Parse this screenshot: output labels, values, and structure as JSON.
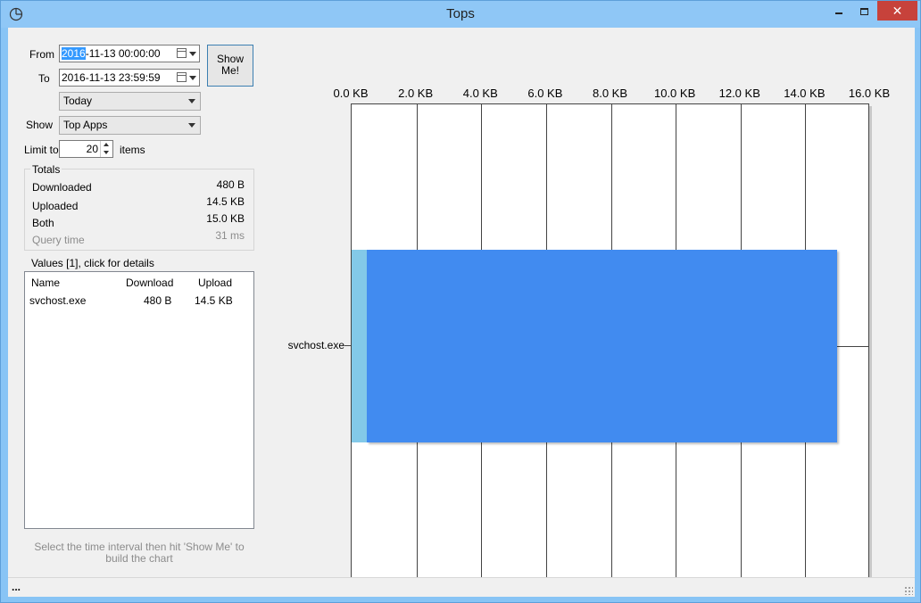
{
  "window": {
    "title": "Tops"
  },
  "form": {
    "from_label": "From",
    "from_selected": "2016",
    "from_rest": "-11-13 00:00:00",
    "to_label": "To",
    "to_value": "2016-11-13 23:59:59",
    "show_button": "Show Me!",
    "range_value": "Today",
    "show_label": "Show",
    "show_value": "Top Apps",
    "limit_label": "Limit to",
    "limit_value": "20",
    "limit_suffix": "items"
  },
  "totals": {
    "title": "Totals",
    "rows": [
      {
        "label": "Downloaded",
        "value": "480 B"
      },
      {
        "label": "Uploaded",
        "value": "14.5 KB"
      },
      {
        "label": "Both",
        "value": "15.0 KB"
      },
      {
        "label": "Query time",
        "value": "31 ms"
      }
    ]
  },
  "values": {
    "title": "Values [1], click for details",
    "columns": [
      "Name",
      "Download",
      "Upload"
    ],
    "rows": [
      {
        "name": "svchost.exe",
        "download": "480 B",
        "upload": "14.5 KB"
      }
    ]
  },
  "hint": "Select the time interval then hit 'Show Me' to build the chart",
  "status": "...",
  "chart_data": {
    "type": "bar",
    "orientation": "horizontal",
    "stacked": true,
    "categories": [
      "svchost.exe"
    ],
    "series": [
      {
        "name": "Download",
        "values_kb": [
          0.469
        ],
        "color": "#83c9e8"
      },
      {
        "name": "Upload",
        "values_kb": [
          14.5
        ],
        "color": "#418bf0"
      }
    ],
    "xlim": [
      0,
      16
    ],
    "xticks": [
      "0.0 KB",
      "2.0 KB",
      "4.0 KB",
      "6.0 KB",
      "8.0 KB",
      "10.0 KB",
      "12.0 KB",
      "14.0 KB",
      "16.0 KB"
    ],
    "grid": true
  }
}
